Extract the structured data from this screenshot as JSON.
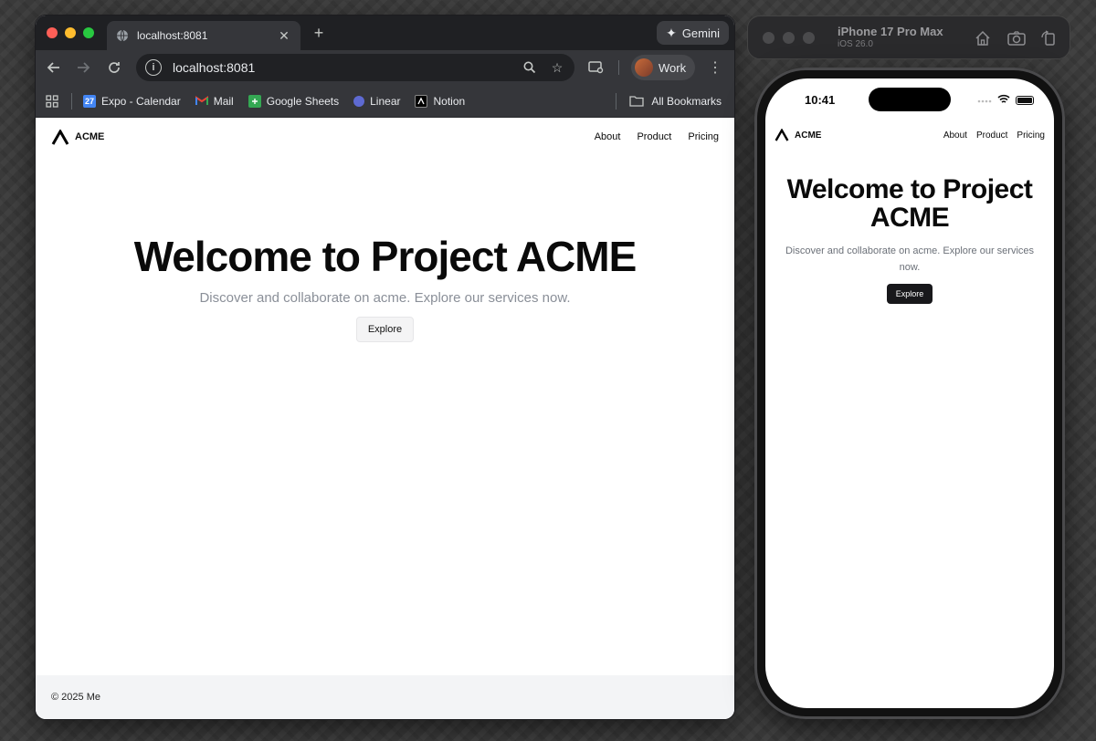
{
  "browser": {
    "tab_title": "localhost:8081",
    "gemini_label": "Gemini",
    "url": "localhost:8081",
    "profile_label": "Work",
    "bookmarks": [
      {
        "label": "Expo - Calendar"
      },
      {
        "label": "Mail"
      },
      {
        "label": "Google Sheets"
      },
      {
        "label": "Linear"
      },
      {
        "label": "Notion"
      }
    ],
    "all_bookmarks_label": "All Bookmarks",
    "calendar_icon_text": "27"
  },
  "site": {
    "logo_text": "ACME",
    "nav": [
      "About",
      "Product",
      "Pricing"
    ],
    "hero_title": "Welcome to Project ACME",
    "hero_subtitle": "Discover and collaborate on acme. Explore our services now.",
    "cta_label": "Explore",
    "footer_text": "© 2025 Me"
  },
  "simulator": {
    "device_name": "iPhone 17 Pro Max",
    "os_version": "iOS 26.0",
    "status_time": "10:41"
  },
  "colors": {
    "accent_dark": "#18181b",
    "muted_text": "#8a8f98",
    "footer_bg": "#f3f4f6"
  }
}
